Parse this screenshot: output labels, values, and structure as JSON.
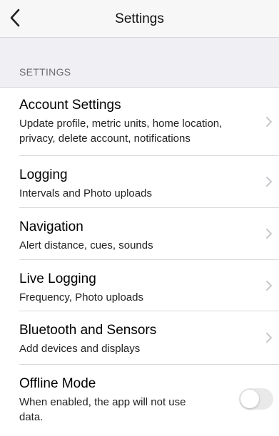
{
  "navbar": {
    "title": "Settings",
    "back_icon": "chevron-left-icon"
  },
  "section": {
    "header": "SETTINGS"
  },
  "items": [
    {
      "title": "Account Settings",
      "subtitle": "Update profile, metric units, home location, privacy, delete account, notifications"
    },
    {
      "title": "Logging",
      "subtitle": "Intervals and Photo uploads"
    },
    {
      "title": "Navigation",
      "subtitle": "Alert distance, cues, sounds"
    },
    {
      "title": "Live Logging",
      "subtitle": "Frequency, Photo uploads"
    },
    {
      "title": "Bluetooth and Sensors",
      "subtitle": "Add devices and displays"
    },
    {
      "title": "Offline Mode",
      "subtitle": "When enabled, the app will not use data.",
      "toggle_on": false
    }
  ],
  "colors": {
    "chevron": "#c7c7cc",
    "toggle_off": "#e9e9ea",
    "section_header": "#6d6d72"
  }
}
